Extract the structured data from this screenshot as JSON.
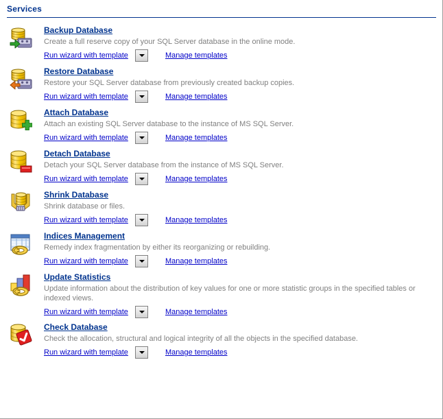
{
  "header": {
    "title": "Services",
    "accent_color": "#00338e"
  },
  "colors": {
    "title_link": "#00338e",
    "action_link": "#0000c8",
    "description": "#808080",
    "rule": "#00338e",
    "background": "#ffffff"
  },
  "common": {
    "run_wizard_label": "Run wizard with template",
    "manage_templates_label": "Manage templates",
    "dropdown_icon": "chevron-down-icon"
  },
  "services": [
    {
      "id": "backup-database",
      "title": "Backup Database",
      "description": "Create a full reserve copy of your SQL Server database in the online mode.",
      "icon": "database-backup-icon"
    },
    {
      "id": "restore-database",
      "title": "Restore Database",
      "description": "Restore your SQL Server database from previously created backup copies.",
      "icon": "database-restore-icon"
    },
    {
      "id": "attach-database",
      "title": "Attach Database",
      "description": "Attach an existing SQL Server database to the instance of MS SQL Server.",
      "icon": "database-add-icon"
    },
    {
      "id": "detach-database",
      "title": "Detach Database",
      "description": "Detach your SQL Server database from the instance of MS SQL Server.",
      "icon": "database-remove-icon"
    },
    {
      "id": "shrink-database",
      "title": "Shrink Database",
      "description": "Shrink database or files.",
      "icon": "database-shrink-icon"
    },
    {
      "id": "indices-management",
      "title": "Indices Management",
      "description": "Remedy index fragmentation by either its reorganizing or rebuilding.",
      "icon": "table-index-icon"
    },
    {
      "id": "update-statistics",
      "title": "Update Statistics",
      "description": "Update information about the distribution of key values for one or more statistic groups in the specified tables or indexed views.",
      "icon": "bar-chart-index-icon"
    },
    {
      "id": "check-database",
      "title": "Check Database",
      "description": "Check the allocation, structural and logical integrity of all the objects in the specified database.",
      "icon": "database-check-icon"
    }
  ]
}
